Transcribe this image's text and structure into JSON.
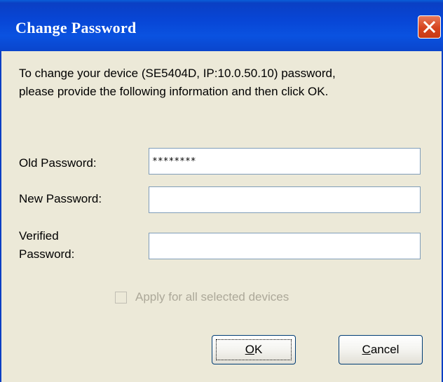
{
  "window": {
    "title": "Change Password",
    "close_icon": "close-icon"
  },
  "instructions": {
    "line1": "To change your device (SE5404D, IP:10.0.50.10) password,",
    "line2": "please provide the following information and then click OK."
  },
  "fields": {
    "old_password": {
      "label": "Old Password:",
      "value": "********"
    },
    "new_password": {
      "label": "New Password:",
      "value": ""
    },
    "verified_password": {
      "label_line1": "Verified",
      "label_line2": "Password:",
      "value": ""
    }
  },
  "apply_all": {
    "label": "Apply for all selected devices",
    "checked": false,
    "enabled": false
  },
  "buttons": {
    "ok_mnemonic": "O",
    "ok_rest": "K",
    "cancel_mnemonic": "C",
    "cancel_rest": "ancel"
  },
  "colors": {
    "titlebar": "#0a46d6",
    "dialog_bg": "#ece9d8",
    "close_button": "#d6431e",
    "disabled_text": "#aca899"
  }
}
